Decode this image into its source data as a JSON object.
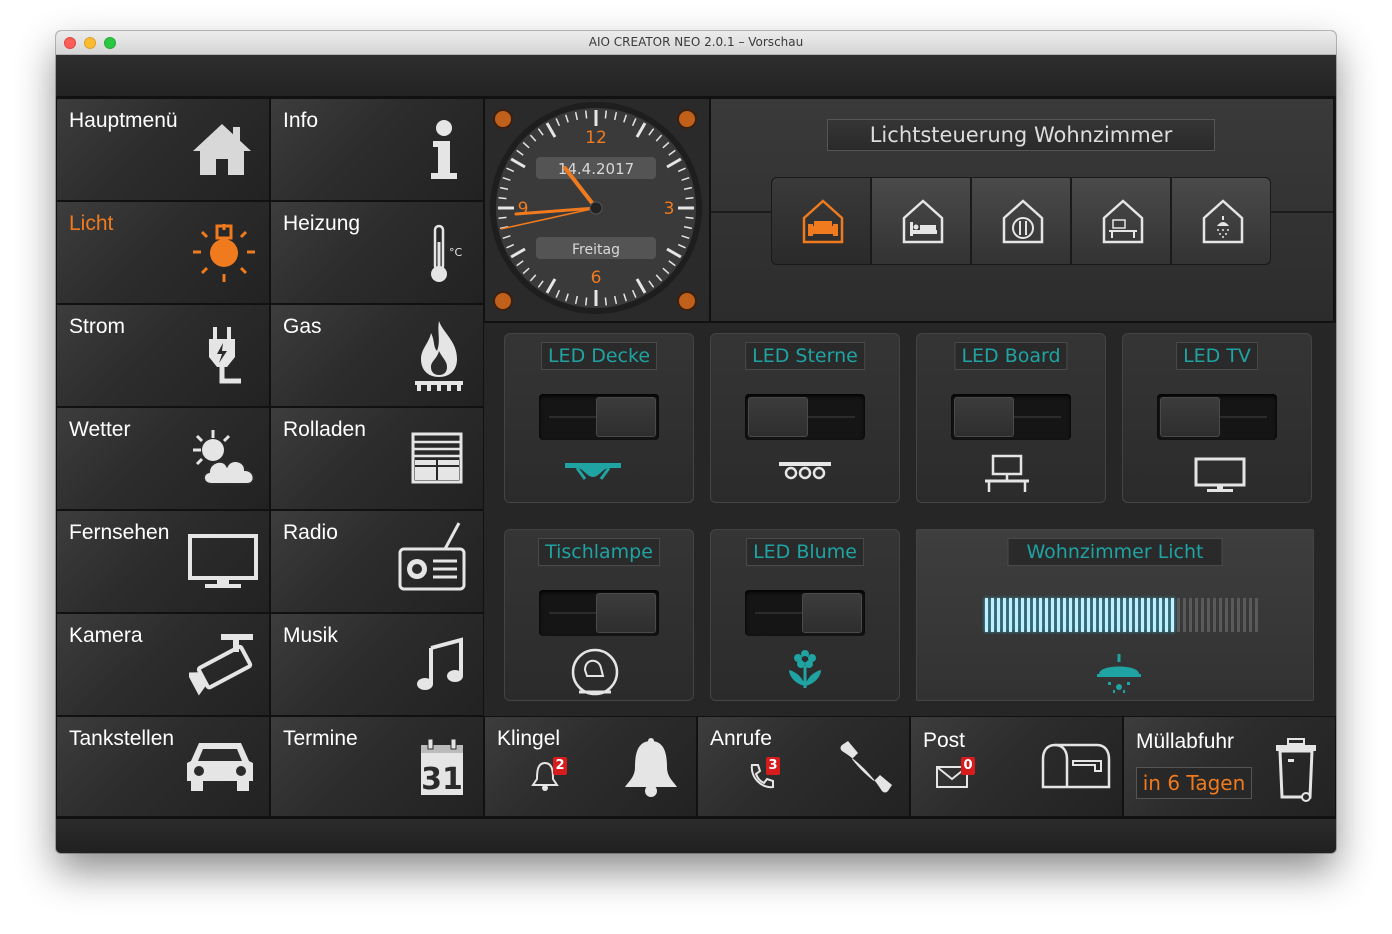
{
  "window": {
    "title": "AIO CREATOR NEO 2.0.1 – Vorschau"
  },
  "menu": [
    {
      "label": "Hauptmenü",
      "icon": "house-icon"
    },
    {
      "label": "Info",
      "icon": "info-icon"
    },
    {
      "label": "Licht",
      "icon": "sun-icon",
      "active": true
    },
    {
      "label": "Heizung",
      "icon": "thermometer-icon"
    },
    {
      "label": "Strom",
      "icon": "plug-icon"
    },
    {
      "label": "Gas",
      "icon": "flame-icon"
    },
    {
      "label": "Wetter",
      "icon": "weather-icon"
    },
    {
      "label": "Rolladen",
      "icon": "shutter-icon"
    },
    {
      "label": "Fernsehen",
      "icon": "tv-icon"
    },
    {
      "label": "Radio",
      "icon": "radio-icon"
    },
    {
      "label": "Kamera",
      "icon": "camera-icon"
    },
    {
      "label": "Musik",
      "icon": "music-note-icon"
    },
    {
      "label": "Tankstellen",
      "icon": "car-icon"
    },
    {
      "label": "Termine",
      "icon": "calendar-icon"
    }
  ],
  "calendar_day": "31",
  "clock": {
    "date": "14.4.2017",
    "weekday": "Freitag",
    "numerals": [
      "12",
      "3",
      "6",
      "9"
    ]
  },
  "lighting": {
    "title": "Lichtsteuerung  Wohnzimmer",
    "rooms": [
      {
        "icon": "living-room-icon",
        "active": true
      },
      {
        "icon": "bedroom-icon"
      },
      {
        "icon": "kitchen-icon"
      },
      {
        "icon": "office-icon"
      },
      {
        "icon": "bathroom-icon"
      }
    ]
  },
  "devices": [
    {
      "label": "LED Decke",
      "state": "on",
      "icon": "ceiling-led-icon"
    },
    {
      "label": "LED Sterne",
      "state": "off",
      "icon": "stars-led-icon"
    },
    {
      "label": "LED Board",
      "state": "off",
      "icon": "desk-icon"
    },
    {
      "label": "LED TV",
      "state": "off",
      "icon": "monitor-icon"
    },
    {
      "label": "Tischlampe",
      "state": "on",
      "icon": "lamp-icon"
    },
    {
      "label": "LED Blume",
      "state": "on",
      "icon": "flower-icon"
    }
  ],
  "dimmer": {
    "label": "Wohnzimmer Licht",
    "level": 0.7,
    "icon": "ceiling-lamp-icon"
  },
  "status": [
    {
      "label": "Klingel",
      "count": "2",
      "icon": "bell-icon"
    },
    {
      "label": "Anrufe",
      "count": "3",
      "icon": "phone-icon"
    },
    {
      "label": "Post",
      "count": "0",
      "icon": "mailbox-icon"
    },
    {
      "label": "Müllabfuhr",
      "sub": "in 6 Tagen",
      "icon": "trash-can-icon"
    }
  ],
  "colors": {
    "accent": "#f07a1e",
    "teal": "#1fa3a3",
    "badge": "#d61c1c"
  }
}
